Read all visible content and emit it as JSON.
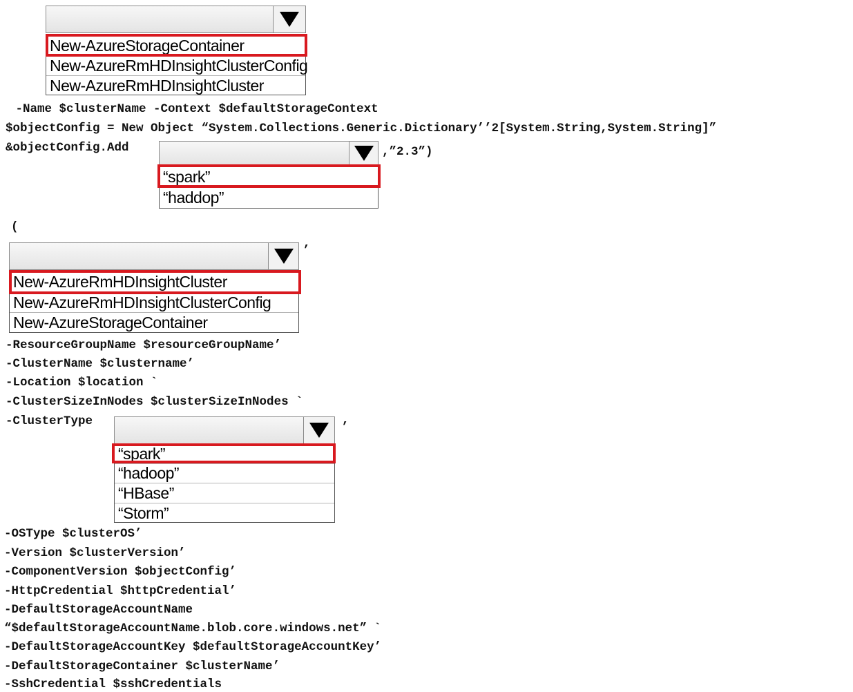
{
  "dropdown1": {
    "options": [
      "New-AzureStorageContainer",
      "New-AzureRmHDInsightClusterConfig",
      "New-AzureRmHDInsightCluster"
    ]
  },
  "code1": {
    "line1": " -Name $clusterName -Context $defaultStorageContext",
    "line2": "$objectConfig = New Object “System.Collections.Generic.Dictionary’’2[System.String,System.String]”",
    "line3": "&objectConfig.Add"
  },
  "dropdown2": {
    "suffix": ",”2.3”)",
    "options": [
      "“spark”",
      "“haddop”"
    ]
  },
  "code2": {
    "paren": "(",
    "comma": "’"
  },
  "dropdown3": {
    "options": [
      "New-AzureRmHDInsightCluster",
      "New-AzureRmHDInsightClusterConfig",
      "New-AzureStorageContainer"
    ]
  },
  "code3": {
    "line1": "-ResourceGroupName $resourceGroupName’",
    "line2": "-ClusterName $clustername’",
    "line3": "-Location $location `",
    "line4": "-ClusterSizeInNodes $clusterSizeInNodes `",
    "line5": "-ClusterType"
  },
  "dropdown4": {
    "suffix": "’",
    "options": [
      "“spark”",
      "“hadoop”",
      "“HBase”",
      "“Storm”"
    ]
  },
  "code4": {
    "line1": "-OSType $clusterOS’",
    "line2": "-Version $clusterVersion’",
    "line3": "-ComponentVersion $objectConfig’",
    "line4": "-HttpCredential $httpCredential’",
    "line5": "-DefaultStorageAccountName",
    "line6": "“$defaultStorageAccountName.blob.core.windows.net” `",
    "line7": "-DefaultStorageAccountKey $defaultStorageAccountKey’",
    "line8": "-DefaultStorageContainer $clusterName’",
    "line9": "-SshCredential $sshCredentials"
  },
  "colors": {
    "selection_border": "#d8191f"
  }
}
